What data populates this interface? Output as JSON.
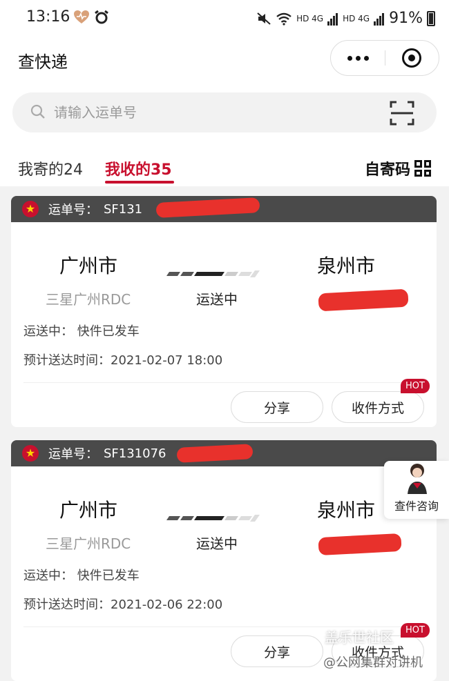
{
  "status_bar": {
    "time": "13:16",
    "signal_1": "HD 4G",
    "signal_2": "HD 4G",
    "battery": "91%"
  },
  "title_bar": {
    "title": "查快递"
  },
  "search": {
    "placeholder": "请输入运单号"
  },
  "tabs": {
    "sent": "我寄的24",
    "received": "我收的35",
    "self_send_code": "自寄码"
  },
  "cards": [
    {
      "waybill_label": "运单号：",
      "waybill_no": "SF131",
      "from_city": "广州市",
      "from_hub": "三星广州RDC",
      "status": "运送中",
      "to_city": "泉州市",
      "latest": "运送中：  快件已发车",
      "eta": "预计送达时间：2021-02-07 18:00",
      "share": "分享",
      "method": "收件方式",
      "hot": "HOT"
    },
    {
      "waybill_label": "运单号：",
      "waybill_no": "SF131076",
      "from_city": "广州市",
      "from_hub": "三星广州RDC",
      "status": "运送中",
      "to_city": "泉州市",
      "latest": "运送中：  快件已发车",
      "eta": "预计送达时间：2021-02-06 22:00",
      "share": "分享",
      "method": "收件方式",
      "hot": "HOT"
    }
  ],
  "consult": {
    "label": "查件咨询"
  },
  "watermark": {
    "line1": "盖乐世社区",
    "line2": "@公网集群对讲机"
  },
  "colors": {
    "brand_red": "#c8102e",
    "header_dark": "#4a4a4a"
  },
  "icons": [
    "heart-icon",
    "alarm-icon",
    "search-icon",
    "scan-icon",
    "qr-code-icon",
    "more-icon",
    "close-icon",
    "sf-badge-icon"
  ]
}
